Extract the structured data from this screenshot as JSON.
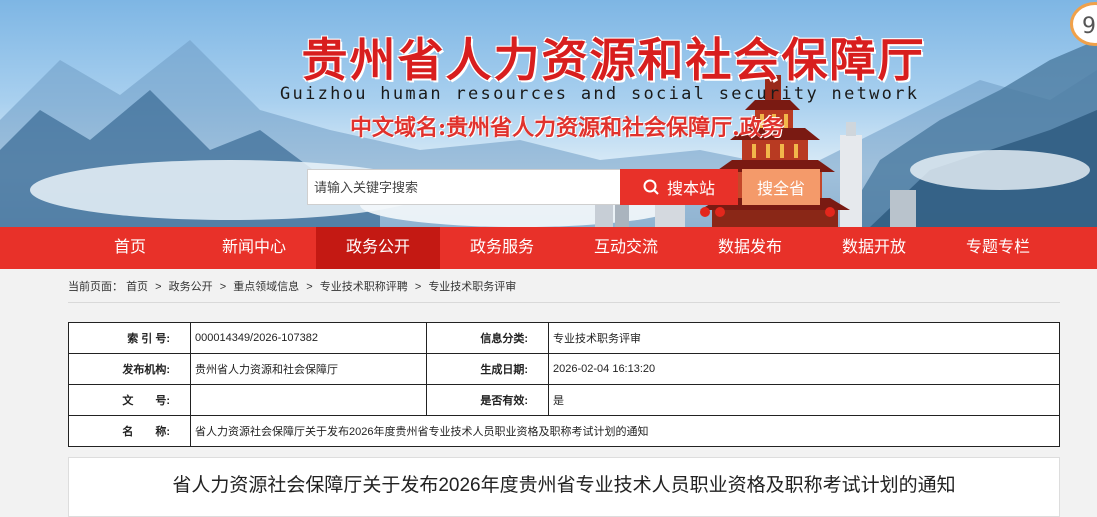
{
  "header": {
    "title": "贵州省人力资源和社会保障厅",
    "subtitle": "Guizhou human resources and social security network",
    "domain_name": "中文域名:贵州省人力资源和社会保障厅.政务",
    "badge": "9"
  },
  "search": {
    "placeholder": "请输入关键字搜索",
    "site_button": "搜本站",
    "province_button": "搜全省"
  },
  "nav": {
    "items": [
      {
        "label": "首页"
      },
      {
        "label": "新闻中心"
      },
      {
        "label": "政务公开"
      },
      {
        "label": "政务服务"
      },
      {
        "label": "互动交流"
      },
      {
        "label": "数据发布"
      },
      {
        "label": "数据开放"
      },
      {
        "label": "专题专栏"
      }
    ],
    "active": "政务公开"
  },
  "breadcrumb": {
    "prefix": "当前页面：",
    "items": [
      "首页",
      "政务公开",
      "重点领域信息",
      "专业技术职称评聘",
      "专业技术职务评审"
    ],
    "separator": ">"
  },
  "info_table": {
    "index_label": "索 引 号:",
    "index_value": "000014349/2026-107382",
    "category_label": "信息分类:",
    "category_value": "专业技术职务评审",
    "publisher_label": "发布机构:",
    "publisher_value": "贵州省人力资源和社会保障厅",
    "date_label": "生成日期:",
    "date_value": "2026-02-04 16:13:20",
    "docno_label": "文　　号:",
    "docno_value": "",
    "valid_label": "是否有效:",
    "valid_value": "是",
    "name_label": "名　　称:",
    "name_value": "省人力资源社会保障厅关于发布2026年度贵州省专业技术人员职业资格及职称考试计划的通知"
  },
  "article": {
    "title": "省人力资源社会保障厅关于发布2026年度贵州省专业技术人员职业资格及职称考试计划的通知"
  },
  "colors": {
    "nav_red": "#e83129",
    "nav_active": "#c41913",
    "title_red": "#d81e1e",
    "search_orange": "#f49a6a"
  }
}
